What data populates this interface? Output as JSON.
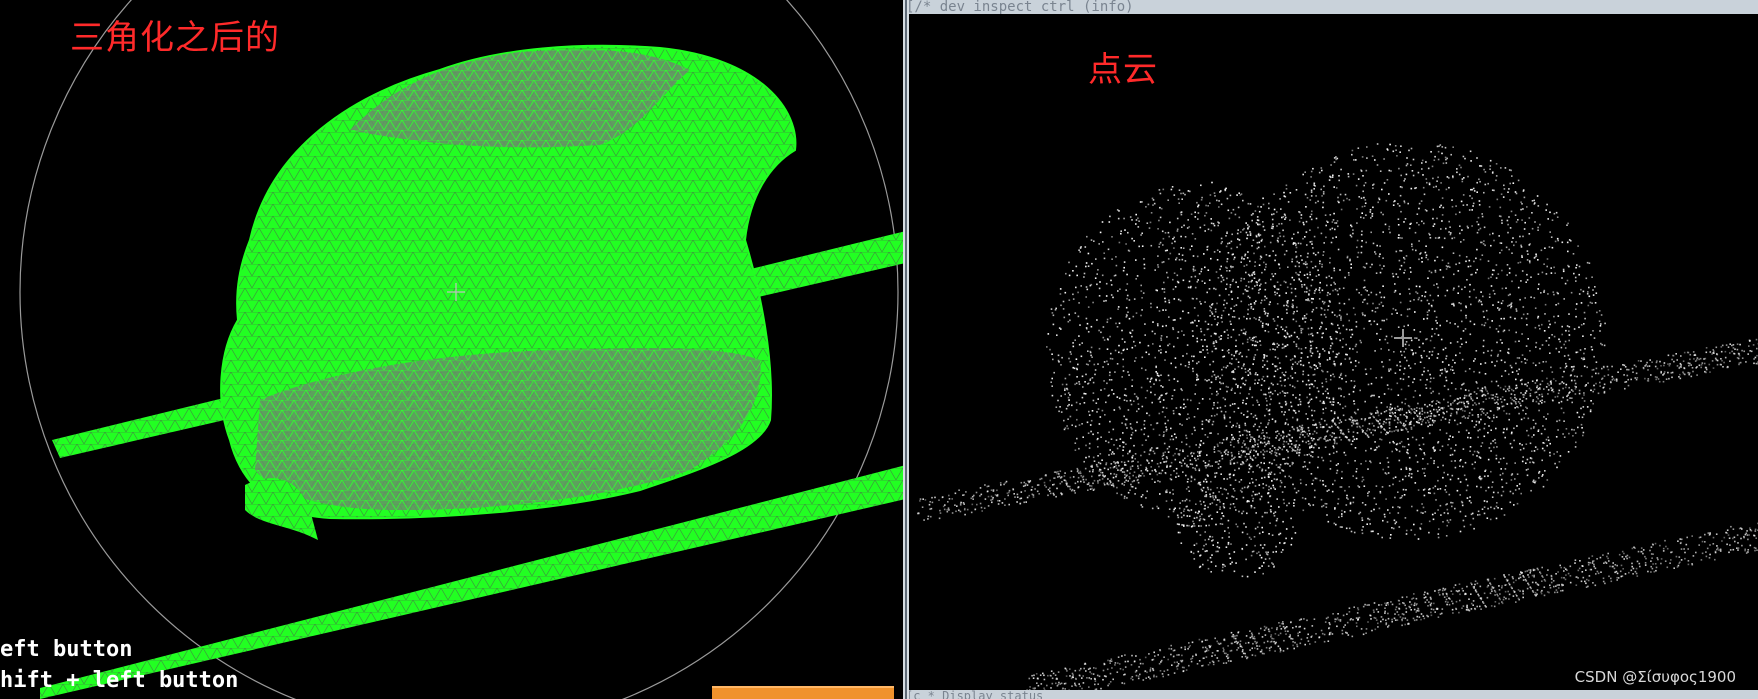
{
  "left_view": {
    "title": "三角化之后的",
    "mouse_help": [
      "eft button",
      "hift + left button"
    ],
    "mesh_color": "#22ff22",
    "wire_color": "#8a8a8a"
  },
  "right_view": {
    "title": "点云",
    "top_strip": "[/* dev_inspect_ctrl (info)",
    "bottom_strip": "[c * Display status",
    "watermark": "CSDN @Σίσυφος1900",
    "point_color": "#ffffff"
  }
}
